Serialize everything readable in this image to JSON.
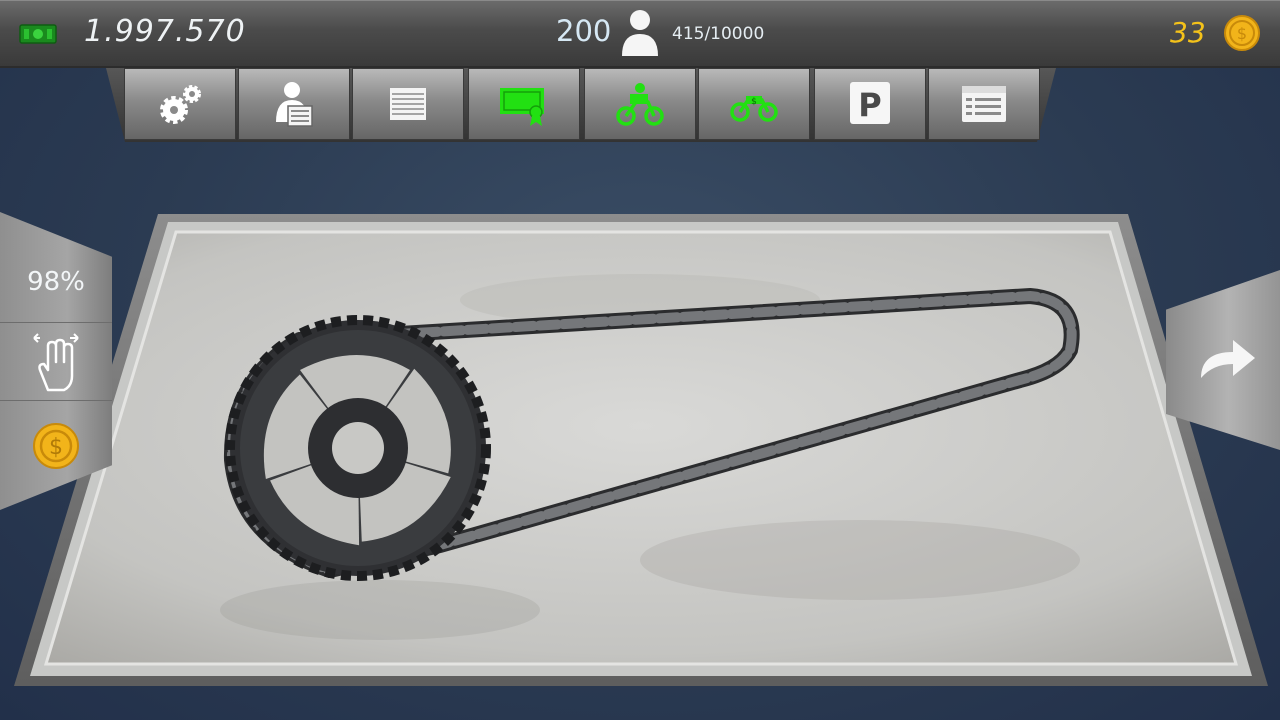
{
  "hud": {
    "money": "1.997.570",
    "workers": "200",
    "xp": "415/10000",
    "gold": "33",
    "icons": {
      "money": "cash-icon",
      "person": "person-icon",
      "gold": "gold-coin-icon"
    }
  },
  "toolbar": {
    "buttons": [
      {
        "name": "settings-button",
        "icon": "gears-icon"
      },
      {
        "name": "shop-button",
        "icon": "shopkeeper-icon"
      },
      {
        "name": "garage-button",
        "icon": "garage-door-icon"
      },
      {
        "name": "certificate-button",
        "icon": "certificate-icon"
      },
      {
        "name": "delivery-bike-button",
        "icon": "delivery-bike-icon"
      },
      {
        "name": "buy-bike-button",
        "icon": "bike-sale-icon"
      },
      {
        "name": "parking-button",
        "icon": "parking-icon"
      },
      {
        "name": "menu-list-button",
        "icon": "browser-list-icon"
      }
    ]
  },
  "left_panel": {
    "zoom": "98%"
  },
  "colors": {
    "accent_green": "#22e012",
    "gold": "#f4c21a",
    "background": "#2b3b52"
  }
}
